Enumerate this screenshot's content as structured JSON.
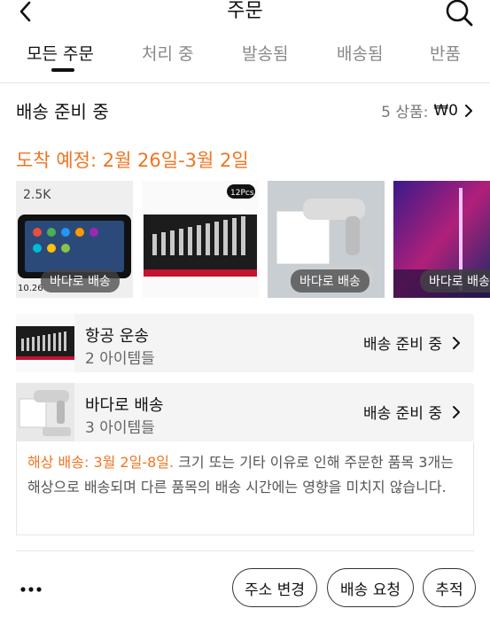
{
  "header": {
    "title": "주문",
    "back_icon": "back-chevron-icon",
    "search_icon": "search-icon"
  },
  "tabs": [
    {
      "label": "모든 주문",
      "active": true
    },
    {
      "label": "처리 중",
      "active": false
    },
    {
      "label": "발송됨",
      "active": false
    },
    {
      "label": "배송됨",
      "active": false
    },
    {
      "label": "반품",
      "active": false
    }
  ],
  "shipment": {
    "title": "배송 준비 중",
    "items_label": "5 상품:",
    "price": "₩0",
    "arrival": "도착 예정: 2월 26일-3월 2일"
  },
  "thumbnails": [
    {
      "product": "car-display",
      "badge": "바다로 배송"
    },
    {
      "product": "wrench-set",
      "badge": ""
    },
    {
      "product": "handheld-vacuum",
      "badge": "바다로 배송"
    },
    {
      "product": "rgb-floor-lamp",
      "badge": "바다로 배송"
    }
  ],
  "thumb_texts": {
    "display_res": "2.5K",
    "display_size": "10.26",
    "wrench_pcs": "12Pcs"
  },
  "groups": [
    {
      "title": "항공 운송",
      "count": "2 아이템들",
      "status": "배송 준비 중"
    },
    {
      "title": "바다로 배송",
      "count": "3 아이템들",
      "status": "배송 준비 중"
    }
  ],
  "notice": {
    "highlight": "해상 배송: 3월 2일-8일.",
    "text": " 크기 또는 기타 이유로 인해 주문한 품목 3개는 해상으로 배송되며 다른 품목의 배송 시간에는 영향을 미치지 않습니다."
  },
  "actions": {
    "change_address": "주소 변경",
    "delivery_request": "배송 요청",
    "track": "추적"
  },
  "colors": {
    "accent": "#f07521",
    "text": "#111111",
    "muted": "#777777",
    "card_bg": "#f4f4f4"
  }
}
